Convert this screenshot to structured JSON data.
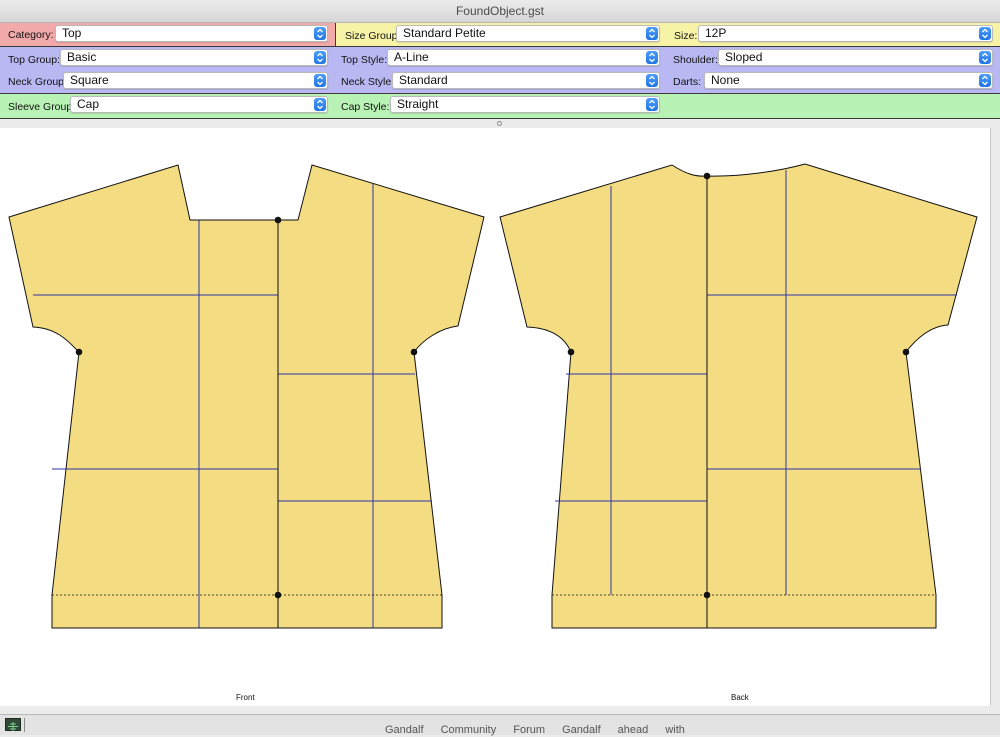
{
  "window": {
    "title": "FoundObject.gst"
  },
  "controls": {
    "category": {
      "label": "Category:",
      "value": "Top"
    },
    "size_group": {
      "label": "Size Group:",
      "value": "Standard Petite"
    },
    "size": {
      "label": "Size:",
      "value": "12P"
    },
    "top_group": {
      "label": "Top Group:",
      "value": "Basic"
    },
    "top_style": {
      "label": "Top Style:",
      "value": "A-Line"
    },
    "shoulder": {
      "label": "Shoulder:",
      "value": "Sloped"
    },
    "neck_group": {
      "label": "Neck Group:",
      "value": "Square"
    },
    "neck_style": {
      "label": "Neck Style:",
      "value": "Standard"
    },
    "darts": {
      "label": "Darts:",
      "value": "None"
    },
    "sleeve_group": {
      "label": "Sleeve Group:",
      "value": "Cap"
    },
    "cap_style": {
      "label": "Cap Style:",
      "value": "Straight"
    }
  },
  "pattern": {
    "front_label": "Front",
    "back_label": "Back",
    "fill_color": "#f4dc82",
    "grid_line_color": "#2d35a8",
    "outline_color": "#111111"
  },
  "bands": {
    "category_color": "#f2a9a9",
    "size_color": "#f6f2a6",
    "style_color": "#b9b8f2",
    "sleeve_color": "#b8f2b4"
  },
  "background_text": "Gandalf Community Forum Gandalf ahead with"
}
